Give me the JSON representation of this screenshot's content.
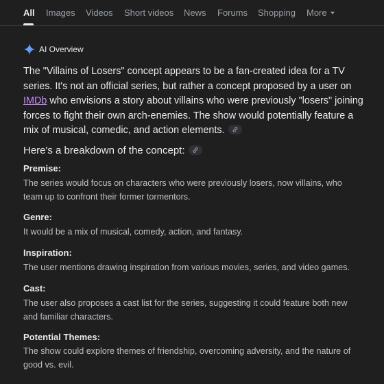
{
  "tabs": [
    {
      "label": "All",
      "active": true
    },
    {
      "label": "Images"
    },
    {
      "label": "Videos"
    },
    {
      "label": "Short videos"
    },
    {
      "label": "News"
    },
    {
      "label": "Forums"
    },
    {
      "label": "Shopping"
    },
    {
      "label": "More"
    }
  ],
  "ai_overview": {
    "label": "AI Overview",
    "icon": "sparkle-icon",
    "intro": {
      "line1": "The \"Villains of Losers\" concept appears to be a fan-created idea for a TV",
      "line2": "series. It's not an official series, but rather a concept proposed by a user on",
      "link_text": "IMDb",
      "line3_rest": " who envisions a story about villains who were previously \"losers\" joining",
      "line4": "forces to fight their own arch-enemies. The show would potentially feature a",
      "line5": "mix of musical, comedic, and action elements."
    },
    "breakdown_heading": "Here's a breakdown of the concept:",
    "sections": [
      {
        "title": "Premise:",
        "lines": [
          "The series would focus on characters who were previously losers, now villains, who",
          "team up to confront their former tormentors."
        ]
      },
      {
        "title": "Genre:",
        "lines": [
          "It would be a mix of musical, comedy, action, and fantasy."
        ]
      },
      {
        "title": "Inspiration:",
        "lines": [
          "The user mentions drawing inspiration from various movies, series, and video games."
        ]
      },
      {
        "title": "Cast:",
        "lines": [
          "The user also proposes a cast list for the series, suggesting it could feature both new",
          "and familiar characters."
        ]
      },
      {
        "title": "Potential Themes:",
        "lines": [
          "The show could explore themes of friendship, overcoming adversity, and the nature of",
          "good vs. evil."
        ]
      }
    ]
  },
  "colors": {
    "background": "#1f1f1f",
    "link": "#c58af9",
    "sparkle": "#8ab4f8"
  }
}
